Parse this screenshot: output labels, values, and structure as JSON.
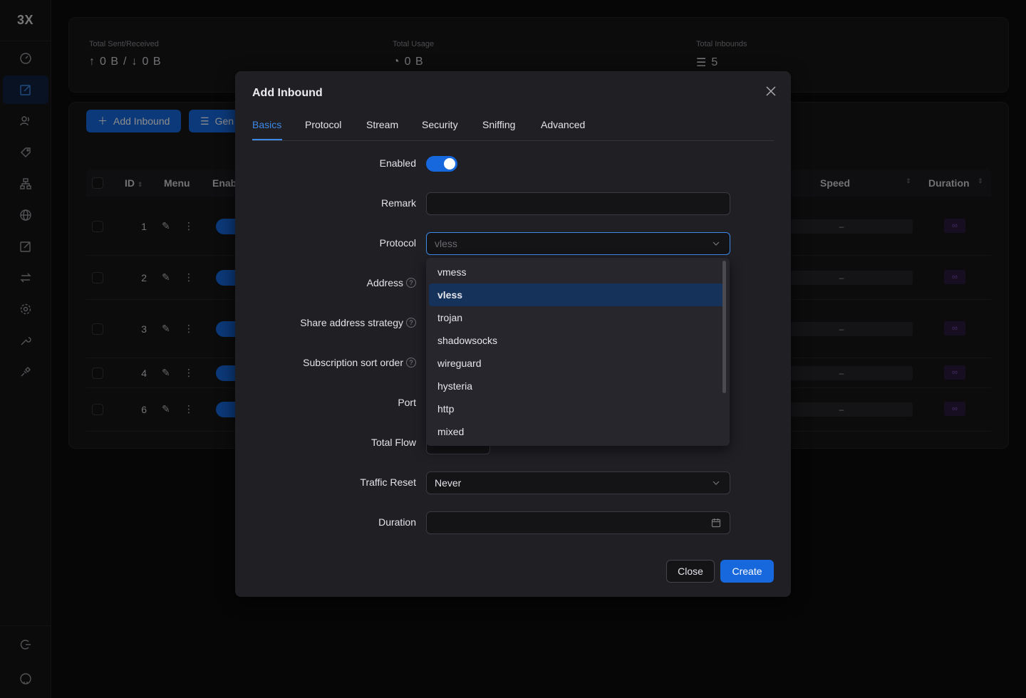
{
  "app": {
    "logo": "3X"
  },
  "stats": {
    "sent_received": {
      "label": "Total Sent/Received",
      "up": "0 B",
      "down": "0 B",
      "sep": "/"
    },
    "usage": {
      "label": "Total Usage",
      "value": "0 B"
    },
    "inbounds": {
      "label": "Total Inbounds",
      "value": "5"
    }
  },
  "toolbar": {
    "add_label": "Add Inbound",
    "general_label": "Gen"
  },
  "table": {
    "headers": {
      "id": "ID",
      "menu": "Menu",
      "enable": "Enab",
      "speed": "Speed",
      "duration": "Duration"
    },
    "rows": [
      {
        "id": "1",
        "speed": "–",
        "duration": "∞"
      },
      {
        "id": "2",
        "speed": "–",
        "duration": "∞"
      },
      {
        "id": "3",
        "speed": "–",
        "duration": "∞"
      },
      {
        "id": "4",
        "speed": "–",
        "duration": "∞"
      },
      {
        "id": "6",
        "speed": "–",
        "duration": "∞"
      }
    ]
  },
  "modal": {
    "title": "Add Inbound",
    "tabs": [
      "Basics",
      "Protocol",
      "Stream",
      "Security",
      "Sniffing",
      "Advanced"
    ],
    "active_tab": "Basics",
    "fields": {
      "enabled": {
        "label": "Enabled",
        "value": true
      },
      "remark": {
        "label": "Remark",
        "value": ""
      },
      "protocol": {
        "label": "Protocol",
        "placeholder": "vless"
      },
      "address": {
        "label": "Address"
      },
      "share_strategy": {
        "label": "Share address strategy"
      },
      "sub_sort": {
        "label": "Subscription sort order"
      },
      "port": {
        "label": "Port"
      },
      "total_flow": {
        "label": "Total Flow"
      },
      "traffic_reset": {
        "label": "Traffic Reset",
        "value": "Never"
      },
      "duration": {
        "label": "Duration",
        "value": ""
      }
    },
    "buttons": {
      "close": "Close",
      "create": "Create"
    }
  },
  "protocol_dropdown": {
    "options": [
      "vmess",
      "vless",
      "trojan",
      "shadowsocks",
      "wireguard",
      "hysteria",
      "http",
      "mixed"
    ],
    "selected": "vless"
  },
  "colors": {
    "accent": "#1668dc",
    "link": "#3c89e8",
    "bg": "#0b0b0c",
    "modal": "#1f1f24"
  }
}
